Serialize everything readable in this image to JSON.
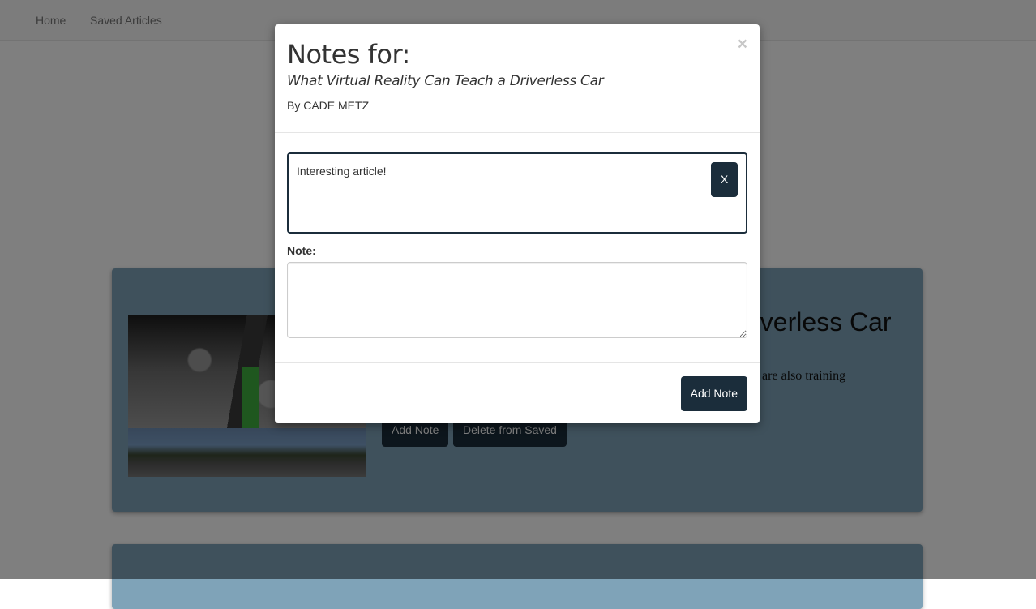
{
  "navbar": {
    "home_label": "Home",
    "saved_label": "Saved Articles"
  },
  "card": {
    "title_visible": "riverless Car",
    "text_visible": "y are also training",
    "add_note_label": "Add Note",
    "delete_label": "Delete from Saved"
  },
  "modal": {
    "close_symbol": "×",
    "title": "Notes for:",
    "article_title": "What Virtual Reality Can Teach a Driverless Car",
    "byline": "By CADE METZ",
    "existing_note": {
      "text": "Interesting article!",
      "delete_label": "X"
    },
    "note_label": "Note:",
    "note_input_value": "",
    "submit_label": "Add Note"
  },
  "colors": {
    "primary_button": "#1b2d3b",
    "card_background": "#7fa3b8",
    "backdrop": "rgba(0,0,0,0.5)"
  }
}
